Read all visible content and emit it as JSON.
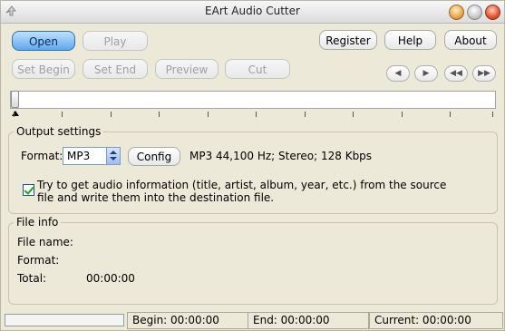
{
  "window": {
    "title": "EArt Audio Cutter"
  },
  "toolbar": {
    "open": "Open",
    "play": "Play",
    "register": "Register",
    "help": "Help",
    "about": "About",
    "set_begin": "Set Begin",
    "set_end": "Set End",
    "preview": "Preview",
    "cut": "Cut"
  },
  "nav_icons": [
    "prev-icon",
    "next-icon",
    "rewind-icon",
    "fast-forward-icon"
  ],
  "output": {
    "legend": "Output settings",
    "format_label": "Format:",
    "format_value": "MP3",
    "config": "Config",
    "format_desc": "MP3 44,100 Hz; Stereo;  128 Kbps",
    "checkbox_text": "Try to get audio information (title, artist, album, year, etc.) from the source file and write them into the destination file.",
    "checkbox_checked": true
  },
  "file_info": {
    "legend": "File info",
    "name_label": "File name:",
    "format_label": "Format:",
    "total_label": "Total:",
    "total_value": "00:00:00"
  },
  "statusbar": {
    "begin": "Begin: 00:00:00",
    "end": "End: 00:00:00",
    "current": "Current: 00:00:00",
    "progress": 0
  }
}
